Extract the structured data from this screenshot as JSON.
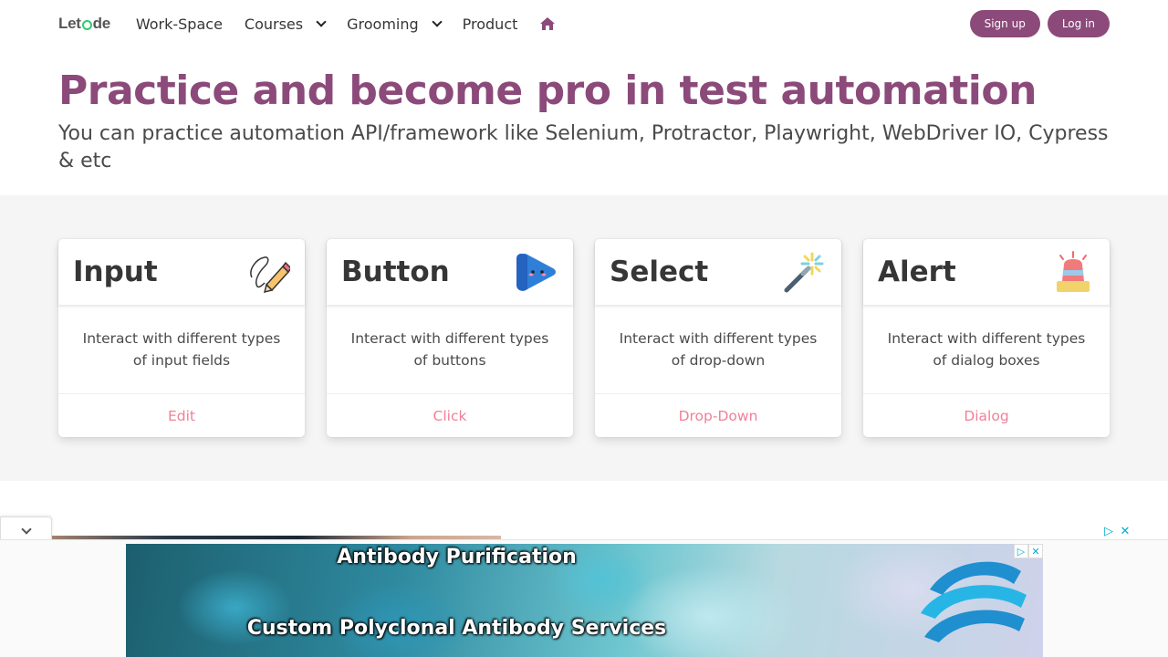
{
  "nav": {
    "logo": "Letcode",
    "items": [
      {
        "label": "Work-Space"
      },
      {
        "label": "Courses"
      },
      {
        "label": "Grooming"
      },
      {
        "label": "Product"
      }
    ],
    "signup_label": "Sign up",
    "login_label": "Log in"
  },
  "hero": {
    "title": "Practice and become pro in test automation",
    "subtitle": "You can practice automation API/framework like Selenium, Protractor, Playwright, WebDriver IO, Cypress & etc"
  },
  "cards": [
    {
      "title": "Input",
      "description": "Interact with different types of input fields",
      "action": "Edit",
      "icon": "pencil-icon"
    },
    {
      "title": "Button",
      "description": "Interact with different types of buttons",
      "action": "Click",
      "icon": "play-button-icon"
    },
    {
      "title": "Select",
      "description": "Interact with different types of drop-down",
      "action": "Drop-Down",
      "icon": "magic-wand-icon"
    },
    {
      "title": "Alert",
      "description": "Interact with different types of dialog boxes",
      "action": "Dialog",
      "icon": "siren-icon"
    }
  ],
  "ad": {
    "line1": "Antibody Purification",
    "line2": "Custom Polyclonal Antibody Services"
  },
  "colors": {
    "accent": "#8b4a7a",
    "link": "#f0809a",
    "section_bg": "#f5f5f5"
  }
}
